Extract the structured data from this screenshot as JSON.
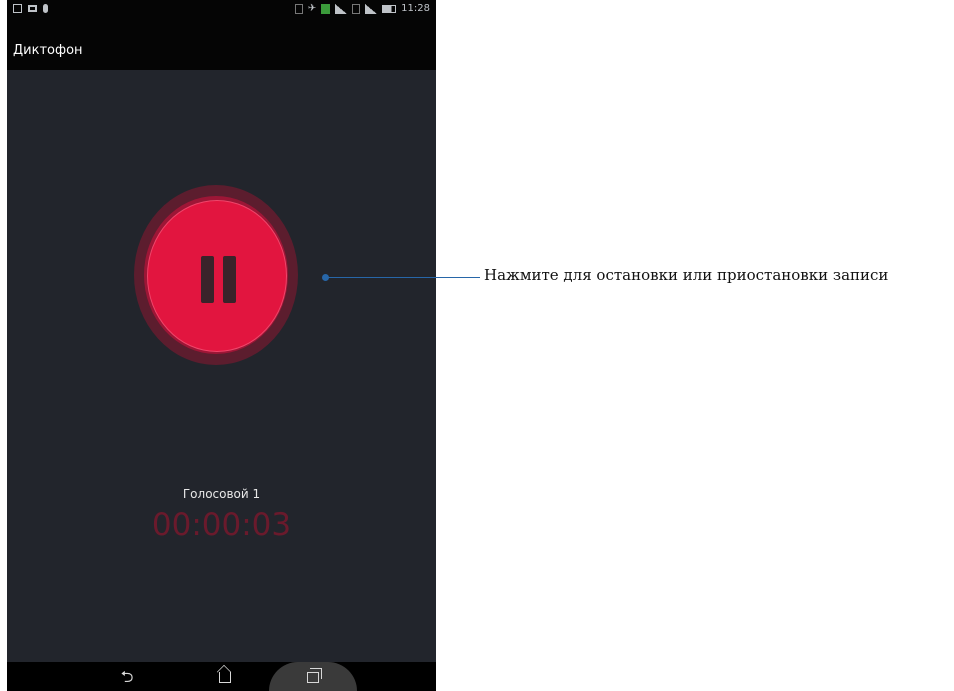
{
  "status_bar": {
    "time": "11:28",
    "icons_left": [
      "gallery-icon",
      "screen-icon",
      "mic-icon"
    ],
    "icons_right": [
      "vibrate-icon",
      "airplane-icon",
      "sim-icon",
      "signal-icon",
      "sim-card-icon",
      "wifi-icon",
      "battery-icon"
    ]
  },
  "app": {
    "title": "Диктофон"
  },
  "recorder": {
    "button_icon": "pause-icon",
    "recording_name": "Голосовой 1",
    "timer": "00:00:03"
  },
  "nav": {
    "back_icon": "back-icon",
    "home_icon": "home-icon",
    "recent_icon": "recent-apps-icon"
  },
  "callout": {
    "text": "Нажмите для остановки или приостановки записи"
  },
  "colors": {
    "background": "#22252c",
    "record_button": "#e2153f",
    "timer": "#6a1a2c",
    "callout_line": "#2766a8"
  }
}
